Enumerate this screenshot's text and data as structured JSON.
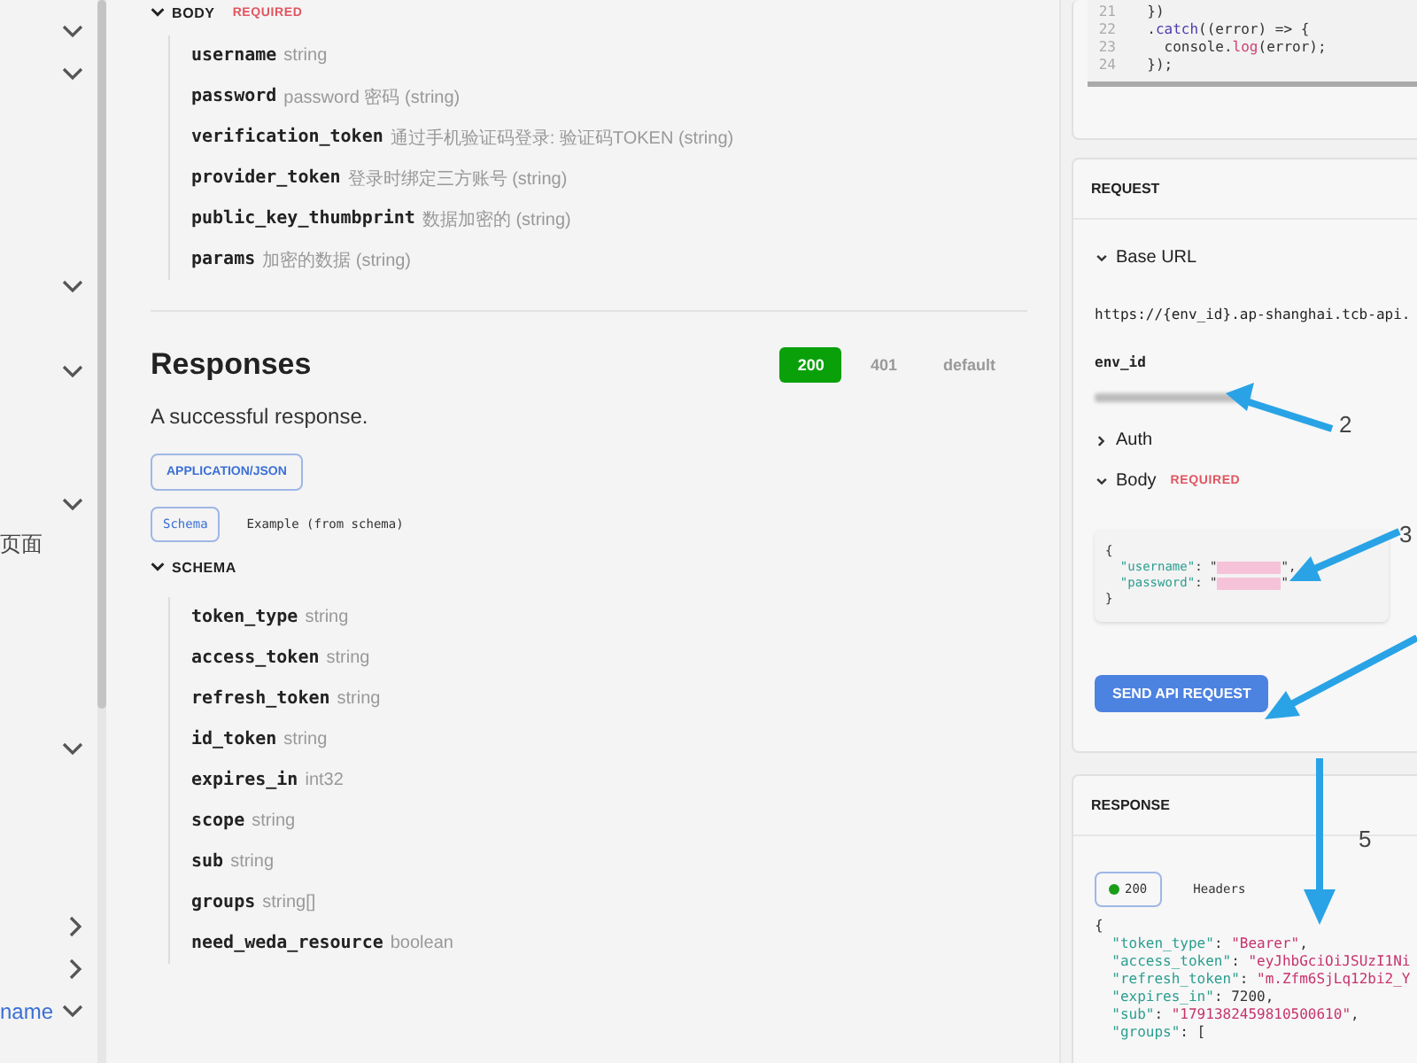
{
  "sidebar": {
    "items": [
      {
        "kind": "group",
        "expanded": true
      },
      {
        "kind": "group",
        "expanded": true
      },
      {
        "kind": "group",
        "expanded": true
      },
      {
        "kind": "group",
        "expanded": true
      },
      {
        "kind": "group",
        "expanded": true
      },
      {
        "kind": "page",
        "label": "页面"
      },
      {
        "kind": "group",
        "expanded": true
      },
      {
        "kind": "group",
        "expanded": false
      },
      {
        "kind": "group",
        "expanded": false
      },
      {
        "kind": "group",
        "label": "name",
        "expanded": true
      }
    ]
  },
  "body": {
    "title": "BODY",
    "required": "REQUIRED",
    "expanded": true,
    "fields": [
      {
        "name": "username",
        "type": "string"
      },
      {
        "name": "password",
        "type": "password 密码 (string)"
      },
      {
        "name": "verification_token",
        "type": "通过手机验证码登录: 验证码TOKEN (string)"
      },
      {
        "name": "provider_token",
        "type": "登录时绑定三方账号 (string)"
      },
      {
        "name": "public_key_thumbprint",
        "type": "数据加密的 (string)"
      },
      {
        "name": "params",
        "type": "加密的数据 (string)"
      }
    ]
  },
  "responses": {
    "title": "Responses",
    "status_tabs": [
      {
        "label": "200",
        "selected": true
      },
      {
        "label": "401",
        "selected": false
      },
      {
        "label": "default",
        "selected": false
      }
    ],
    "description": "A successful response.",
    "content_type": "APPLICATION/JSON",
    "view_tabs": [
      {
        "label": "Schema",
        "selected": true
      },
      {
        "label": "Example (from schema)",
        "selected": false
      }
    ],
    "schema": {
      "title": "SCHEMA",
      "expanded": true,
      "fields": [
        {
          "name": "token_type",
          "type": "string"
        },
        {
          "name": "access_token",
          "type": "string"
        },
        {
          "name": "refresh_token",
          "type": "string"
        },
        {
          "name": "id_token",
          "type": "string"
        },
        {
          "name": "expires_in",
          "type": "int32"
        },
        {
          "name": "scope",
          "type": "string"
        },
        {
          "name": "sub",
          "type": "string"
        },
        {
          "name": "groups",
          "type": "string[]"
        },
        {
          "name": "need_weda_resource",
          "type": "boolean"
        }
      ]
    }
  },
  "code_sample": {
    "lines": [
      {
        "number": "21",
        "tokens": [
          {
            "t": "  })",
            "kind": "plain"
          }
        ]
      },
      {
        "number": "22",
        "tokens": [
          {
            "t": "  .",
            "kind": "plain"
          },
          {
            "t": "catch",
            "kind": "method"
          },
          {
            "t": "((error) => {",
            "kind": "plain"
          }
        ]
      },
      {
        "number": "23",
        "tokens": [
          {
            "t": "    console.",
            "kind": "plain"
          },
          {
            "t": "log",
            "kind": "call"
          },
          {
            "t": "(error);",
            "kind": "plain"
          }
        ]
      },
      {
        "number": "24",
        "tokens": [
          {
            "t": "  });",
            "kind": "plain"
          }
        ]
      }
    ]
  },
  "request": {
    "title": "REQUEST",
    "base_url": {
      "label": "Base URL",
      "expanded": true,
      "url": "https://{env_id}.ap-shanghai.tcb-api.",
      "param": "env_id"
    },
    "auth": {
      "label": "Auth",
      "expanded": false
    },
    "body": {
      "label": "Body",
      "required": "REQUIRED",
      "expanded": true,
      "lines": [
        [
          {
            "t": "{",
            "kind": "punct"
          }
        ],
        [
          {
            "t": "  \"username\"",
            "kind": "key"
          },
          {
            "t": ": \"",
            "kind": "punct"
          },
          {
            "kind": "redacted"
          },
          {
            "t": "\",",
            "kind": "punct"
          }
        ],
        [
          {
            "t": "  \"password\"",
            "kind": "key"
          },
          {
            "t": ": \"",
            "kind": "punct"
          },
          {
            "kind": "redacted"
          },
          {
            "t": "\"",
            "kind": "punct"
          }
        ],
        [
          {
            "t": "}",
            "kind": "punct"
          }
        ]
      ]
    },
    "send_button": "SEND API REQUEST"
  },
  "response": {
    "title": "RESPONSE",
    "status": {
      "label": "200",
      "color": "#1a9e1a",
      "selected": true
    },
    "headers_tab": "Headers",
    "lines": [
      [
        {
          "t": "{",
          "kind": "punct"
        }
      ],
      [
        {
          "t": "  \"token_type\"",
          "kind": "key"
        },
        {
          "t": ": ",
          "kind": "punct"
        },
        {
          "t": "\"Bearer\"",
          "kind": "string"
        },
        {
          "t": ",",
          "kind": "punct"
        }
      ],
      [
        {
          "t": "  \"access_token\"",
          "kind": "key"
        },
        {
          "t": ": ",
          "kind": "punct"
        },
        {
          "t": "\"eyJhbGciOiJSUzI1Ni",
          "kind": "string"
        }
      ],
      [
        {
          "t": "  \"refresh_token\"",
          "kind": "key"
        },
        {
          "t": ": ",
          "kind": "punct"
        },
        {
          "t": "\"m.Zfm6SjLq12bi2_Y",
          "kind": "string"
        }
      ],
      [
        {
          "t": "  \"expires_in\"",
          "kind": "key"
        },
        {
          "t": ": 7200,",
          "kind": "punct"
        }
      ],
      [
        {
          "t": "  \"sub\"",
          "kind": "key"
        },
        {
          "t": ": ",
          "kind": "punct"
        },
        {
          "t": "\"1791382459810500610\"",
          "kind": "string"
        },
        {
          "t": ",",
          "kind": "punct"
        }
      ],
      [
        {
          "t": "  \"groups\"",
          "kind": "key"
        },
        {
          "t": ": [",
          "kind": "punct"
        }
      ]
    ]
  },
  "annotations": [
    {
      "number": "2"
    },
    {
      "number": "3"
    },
    {
      "number": "5"
    }
  ]
}
